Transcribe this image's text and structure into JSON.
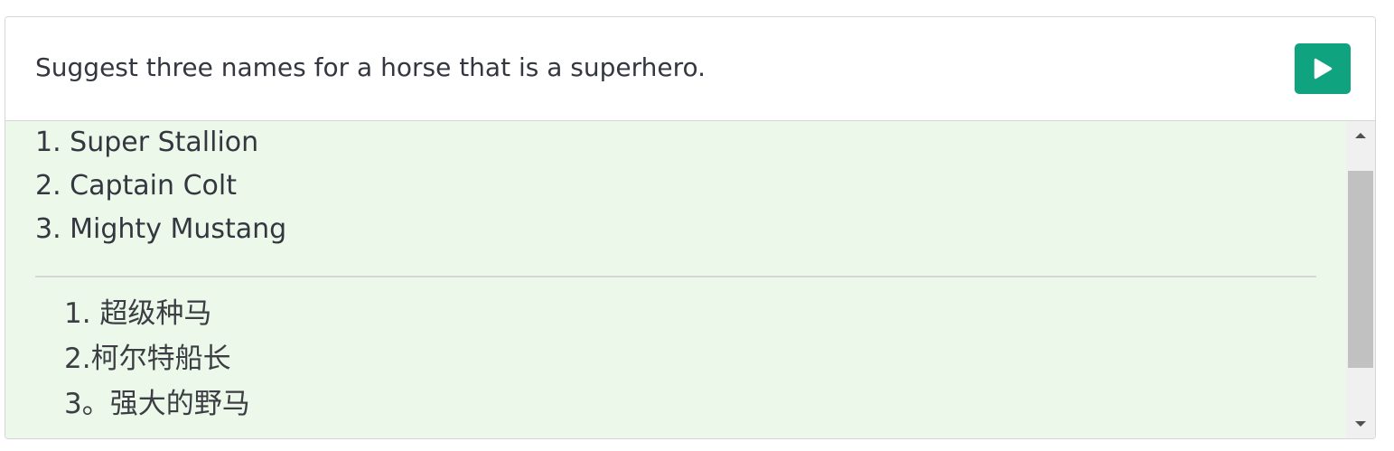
{
  "prompt": {
    "text": "Suggest three names for a horse that is a superhero."
  },
  "run_button": {
    "icon": "play-icon",
    "color": "#10a37f"
  },
  "output": {
    "background": "#ebf8ea",
    "english_lines": [
      "1. Super Stallion",
      "2. Captain Colt",
      "3. Mighty Mustang"
    ],
    "chinese_lines": [
      "1. 超级种马",
      "2.柯尔特船长",
      "3。强大的野马"
    ]
  },
  "scrollbar": {
    "up_icon": "arrow-up-icon",
    "down_icon": "arrow-down-icon"
  }
}
